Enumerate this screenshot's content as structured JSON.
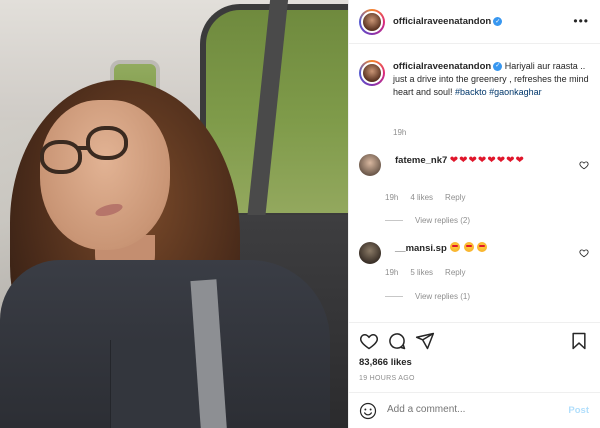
{
  "header": {
    "username": "officialraveenatandon",
    "more_icon": "more-horizontal-icon"
  },
  "caption": {
    "username": "officialraveenatandon",
    "text": " Hariyali aur raasta .. just a drive into the greenery , refreshes the mind heart and soul! ",
    "hashtags": [
      "#backto",
      "#gaonkaghar"
    ],
    "time": "19h"
  },
  "comments": [
    {
      "username": "fateme_nk7",
      "text_hearts": "❤❤❤❤❤❤❤❤",
      "time": "19h",
      "likes": "4 likes",
      "reply_label": "Reply",
      "view_replies": "View replies (2)"
    },
    {
      "username": "__mansi.sp",
      "emoji_count": 3,
      "time": "19h",
      "likes": "5 likes",
      "reply_label": "Reply",
      "view_replies": "View replies (1)"
    }
  ],
  "actions": {
    "like_icon": "heart-outline-icon",
    "comment_icon": "comment-icon",
    "share_icon": "share-icon",
    "save_icon": "bookmark-icon"
  },
  "likes_count": "83,866 likes",
  "posted_ago": "19 HOURS AGO",
  "add_comment": {
    "placeholder": "Add a comment...",
    "post_label": "Post"
  },
  "colors": {
    "link": "#00376b",
    "verified": "#3897f0",
    "heart": "#e0162b",
    "post_disabled": "#b2dffc",
    "muted": "#8e8e8e"
  }
}
